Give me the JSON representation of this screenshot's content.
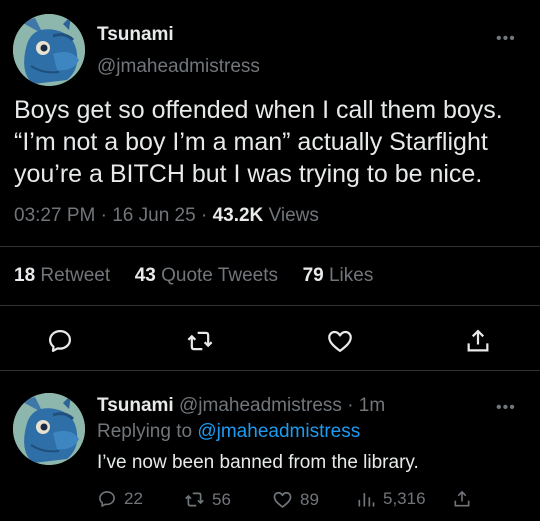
{
  "colors": {
    "background": "#000000",
    "text_primary": "#e7e9ea",
    "text_secondary": "#71767b",
    "link": "#1d9bf0",
    "divider": "#2f3336"
  },
  "main_tweet": {
    "display_name": "Tsunami",
    "handle": "@jmaheadmistress",
    "more_icon": "more-horizontal-icon",
    "text_lines": [
      "Boys get so offended when I call them boys.",
      "“I’m not a boy I’m a man” actually Starflight",
      "you’re a BITCH but I was trying to be nice."
    ],
    "time": "03:27 PM",
    "date": "16 Jun 25",
    "separator": "·",
    "views_count": "43.2K",
    "views_label": "Views",
    "stats": {
      "retweets_count": "18",
      "retweets_label": "Retweet",
      "quotes_count": "43",
      "quotes_label": "Quote Tweets",
      "likes_count": "79",
      "likes_label": "Likes"
    },
    "actions": [
      "reply-icon",
      "retweet-icon",
      "heart-icon",
      "share-icon"
    ]
  },
  "reply_tweet": {
    "display_name": "Tsunami",
    "handle": "@jmaheadmistress",
    "separator": "·",
    "time_ago": "1m",
    "replying_label": "Replying to",
    "replying_handle": "@jmaheadmistress",
    "text": "I’ve now been banned from the library.",
    "replies": "22",
    "retweets": "56",
    "likes": "89",
    "views": "5,316"
  }
}
